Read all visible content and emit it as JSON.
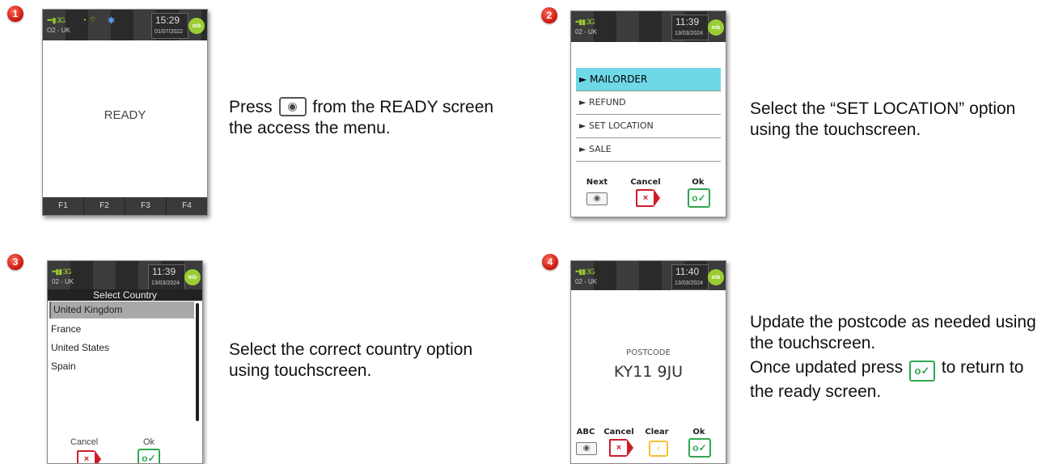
{
  "steps": [
    {
      "number": "1",
      "screen": {
        "carrier": "O2 - UK",
        "network": "3G",
        "time": "15:29",
        "date": "01/07/2022",
        "logo": "mb",
        "status": "READY",
        "fkeys": [
          "F1",
          "F2",
          "F3",
          "F4"
        ]
      },
      "instruction": {
        "before": "Press",
        "after": "from the READY screen the access the menu.",
        "icon": "menu-key-icon"
      }
    },
    {
      "number": "2",
      "screen": {
        "carrier": "02 - UK",
        "network": "3G",
        "time": "11:39",
        "date": "13/03/2024",
        "logo": "mb",
        "menu": [
          "MAILORDER",
          "REFUND",
          "SET LOCATION",
          "SALE"
        ],
        "buttons": [
          "Next",
          "Cancel",
          "Ok"
        ]
      },
      "instruction": {
        "text": "Select the “SET LOCATION” option using the touchscreen."
      }
    },
    {
      "number": "3",
      "screen": {
        "carrier": "02 - UK",
        "network": "3G",
        "time": "11:39",
        "date": "13/03/2024",
        "logo": "mb",
        "heading": "Select Country",
        "countries": [
          "United Kingdom",
          "France",
          "United States",
          "Spain"
        ],
        "buttons": [
          "Cancel",
          "Ok"
        ]
      },
      "instruction": {
        "text": "Select the correct country option using touchscreen."
      }
    },
    {
      "number": "4",
      "screen": {
        "carrier": "02 - UK",
        "network": "3G",
        "time": "11:40",
        "date": "13/03/2024",
        "logo": "mb",
        "field_label": "POSTCODE",
        "field_value": "KY11 9JU",
        "buttons": [
          "ABC",
          "Cancel",
          "Clear",
          "Ok"
        ]
      },
      "instruction": {
        "text1": "Update the postcode as needed using the touchscreen.",
        "before": "Once updated press",
        "after": "to return to the ready screen.",
        "icon": "ok-key-icon"
      }
    }
  ],
  "colors": {
    "badge": "#d8241a",
    "highlight": "#6fd8e6",
    "ok": "#2fa84f",
    "cancel": "#d01c2a",
    "clear": "#f2c230",
    "logo": "#9acd32"
  }
}
